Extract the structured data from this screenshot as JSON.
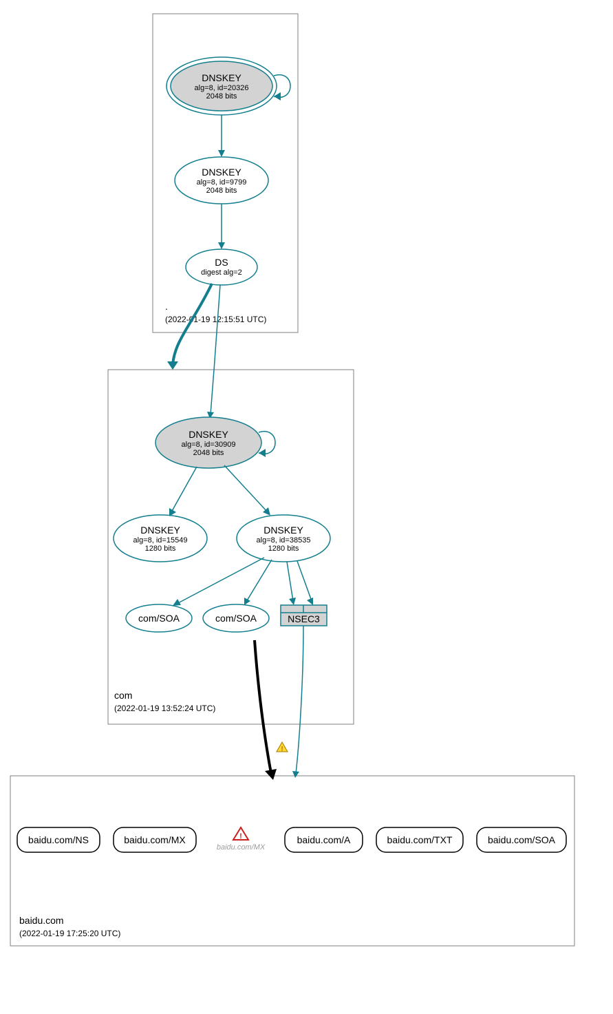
{
  "colors": {
    "secure": "#127e8e",
    "gray": "#d3d3d3"
  },
  "zones": [
    {
      "name": ".",
      "timestamp": "(2022-01-19 12:15:51 UTC)",
      "nodes": {
        "ksk": {
          "title": "DNSKEY",
          "sub1": "alg=8, id=20326",
          "sub2": "2048 bits"
        },
        "zsk": {
          "title": "DNSKEY",
          "sub1": "alg=8, id=9799",
          "sub2": "2048 bits"
        },
        "ds": {
          "title": "DS",
          "sub1": "digest alg=2"
        }
      }
    },
    {
      "name": "com",
      "timestamp": "(2022-01-19 13:52:24 UTC)",
      "nodes": {
        "ksk": {
          "title": "DNSKEY",
          "sub1": "alg=8, id=30909",
          "sub2": "2048 bits"
        },
        "zsk1": {
          "title": "DNSKEY",
          "sub1": "alg=8, id=15549",
          "sub2": "1280 bits"
        },
        "zsk2": {
          "title": "DNSKEY",
          "sub1": "alg=8, id=38535",
          "sub2": "1280 bits"
        },
        "soa1": {
          "title": "com/SOA"
        },
        "soa2": {
          "title": "com/SOA"
        },
        "nsec3": {
          "title": "NSEC3"
        }
      }
    },
    {
      "name": "baidu.com",
      "timestamp": "(2022-01-19 17:25:20 UTC)",
      "nodes": {
        "ns": {
          "title": "baidu.com/NS"
        },
        "mx": {
          "title": "baidu.com/MX"
        },
        "mxerr": {
          "title": "baidu.com/MX"
        },
        "a": {
          "title": "baidu.com/A"
        },
        "txt": {
          "title": "baidu.com/TXT"
        },
        "soa": {
          "title": "baidu.com/SOA"
        }
      }
    }
  ]
}
